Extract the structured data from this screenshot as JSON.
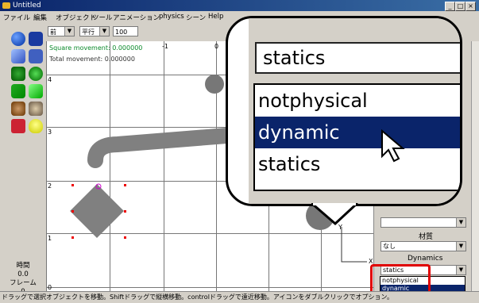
{
  "window": {
    "title": "Untitled",
    "controls": [
      "_",
      "□",
      "×"
    ]
  },
  "menu": [
    "ファイル",
    "編集",
    "オブジェクト",
    "ツール",
    "アニメーション",
    "physics",
    "シーン",
    "Help"
  ],
  "toolbar": {
    "view_select": "前",
    "mode_select": "平行",
    "zoom_value": "100"
  },
  "canvas": {
    "square_movement": "Square movement: 0.000000",
    "total_movement": "Total movement: 0.000000",
    "axis_labels": {
      "x_neg1": "-1",
      "x_0": "0",
      "y_4": "4",
      "y_3": "3",
      "y_2": "2",
      "y_1": "1",
      "y_0": "0",
      "axis_x": "X",
      "axis_y": "Y"
    }
  },
  "left_status": {
    "time_label": "時間",
    "time_value": "0.0",
    "frame_label": "フレーム",
    "frame_value": "0"
  },
  "right_panel": {
    "material_label": "材質",
    "material_value": "なし",
    "dynamics_label": "Dynamics",
    "dynamics_value": "statics",
    "options": [
      "notphysical",
      "dynamic",
      "statics"
    ],
    "selected_option": "dynamic"
  },
  "zoom_callout": {
    "combo_value": "statics",
    "options": [
      "notphysical",
      "dynamic",
      "statics"
    ],
    "selected_option": "dynamic"
  },
  "statusbar": {
    "text": "ドラッグで選択オブジェクトを移動。Shiftドラッグで縦横移動。controlドラッグで遠近移動。アイコンをダブルクリックでオプション。"
  },
  "colors": {
    "selection": "#0a246a",
    "highlight": "#e00000",
    "object": "#808080",
    "hud": "#0a8a2a"
  }
}
